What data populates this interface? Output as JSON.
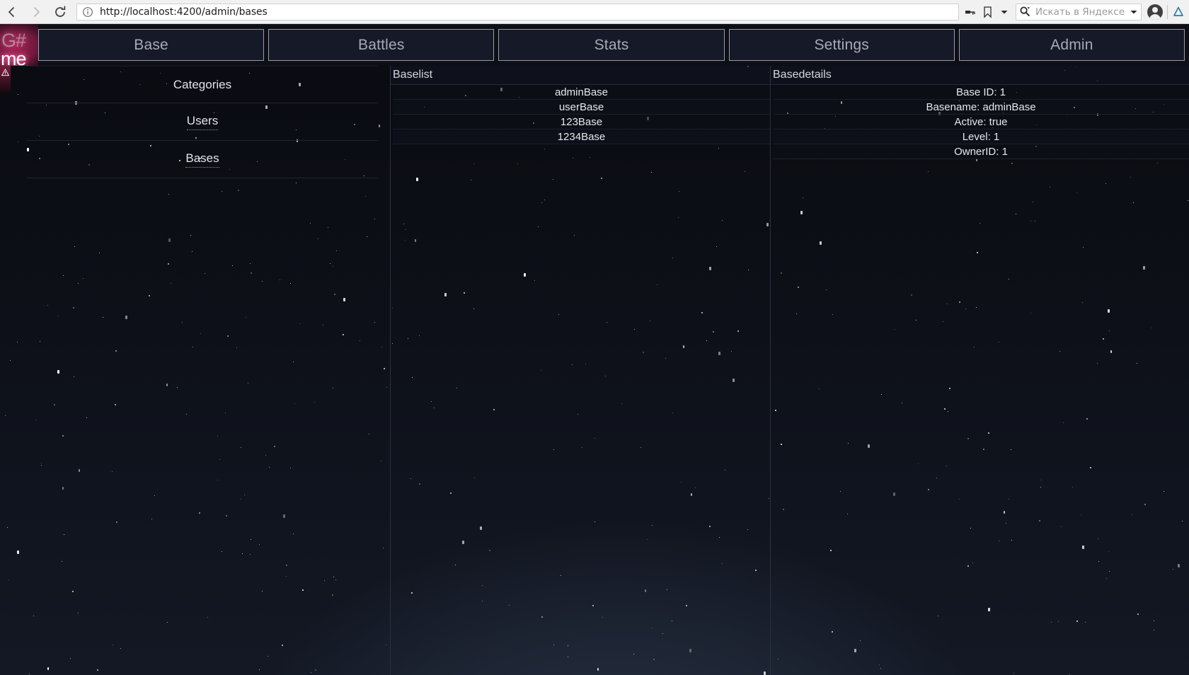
{
  "browser": {
    "back_label": "Back",
    "forward_label": "Forward",
    "reload_label": "Reload",
    "url": "http://localhost:4200/admin/bases",
    "info_icon": "info-circle-icon",
    "key_icon": "password-key-icon",
    "bookmark_icon": "bookmark-icon",
    "dropdown_icon": "chevron-down-icon",
    "search_icon": "search-magnifier-icon",
    "search_placeholder": "Искать в Яндексе",
    "search_value": "",
    "profile_icon": "user-avatar-icon",
    "yandex_icon": "yandex-browser-icon"
  },
  "app": {
    "logo": {
      "line1": "G#",
      "line2": "me",
      "glow_color": "#ff4f92"
    },
    "warning_icon": "warning-triangle-icon",
    "tabs": [
      {
        "label": "Base",
        "name": "tab-base"
      },
      {
        "label": "Battles",
        "name": "tab-battles"
      },
      {
        "label": "Stats",
        "name": "tab-stats"
      },
      {
        "label": "Settings",
        "name": "tab-settings"
      },
      {
        "label": "Admin",
        "name": "tab-admin"
      }
    ],
    "left_panel": {
      "header": "Categories",
      "items": [
        {
          "label": "Users"
        },
        {
          "label": "Bases"
        }
      ]
    },
    "base_list": {
      "title": "Baselist",
      "items": [
        {
          "label": "adminBase"
        },
        {
          "label": "userBase"
        },
        {
          "label": "123Base"
        },
        {
          "label": "1234Base"
        }
      ]
    },
    "base_details": {
      "title": "Basedetails",
      "rows": [
        {
          "label": "Base ID: 1"
        },
        {
          "label": "Basename: adminBase"
        },
        {
          "label": "Active: true"
        },
        {
          "label": "Level: 1"
        },
        {
          "label": "OwnerID: 1"
        }
      ]
    },
    "colors": {
      "tab_bg": "#161a28",
      "tab_border": "#9a9aa4",
      "tab_text": "#a9aab4",
      "space_top": "#0a0b11",
      "space_bottom": "#131824",
      "logo_pink": "#8e2249"
    }
  }
}
